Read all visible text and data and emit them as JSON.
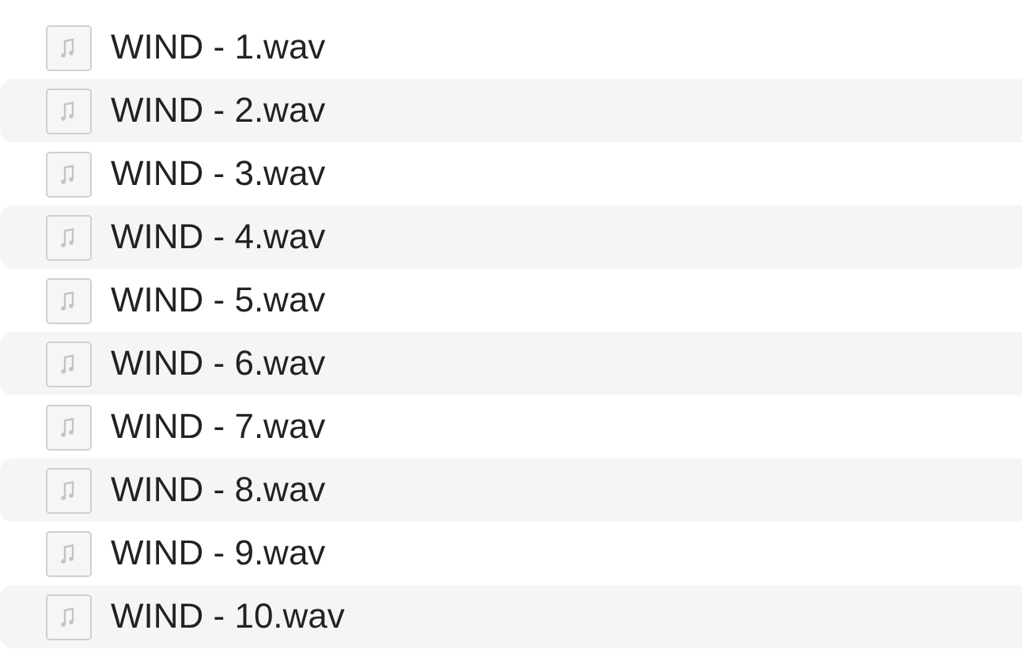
{
  "files": [
    {
      "name": "WIND - 1.wav"
    },
    {
      "name": "WIND - 2.wav"
    },
    {
      "name": "WIND - 3.wav"
    },
    {
      "name": "WIND - 4.wav"
    },
    {
      "name": "WIND - 5.wav"
    },
    {
      "name": "WIND - 6.wav"
    },
    {
      "name": "WIND - 7.wav"
    },
    {
      "name": "WIND - 8.wav"
    },
    {
      "name": "WIND - 9.wav"
    },
    {
      "name": "WIND - 10.wav"
    }
  ]
}
